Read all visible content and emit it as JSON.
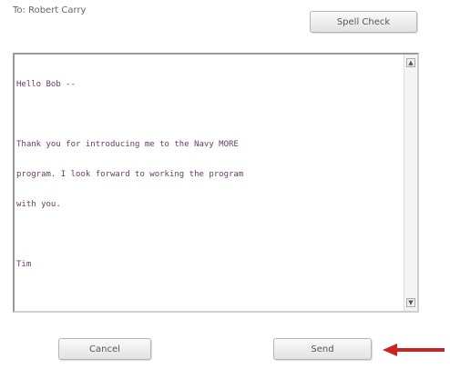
{
  "header": {
    "to_line": "To: Robert Carry"
  },
  "toolbar": {
    "spell_check_label": "Spell Check"
  },
  "message": {
    "lines": [
      "Hello Bob --",
      "",
      "Thank you for introducing me to the Navy MORE",
      "program. I look forward to working the program",
      "with you.",
      "",
      "Tim"
    ]
  },
  "actions": {
    "cancel_label": "Cancel",
    "send_label": "Send"
  },
  "icons": {
    "scroll_up": "scroll-up-icon",
    "scroll_down": "scroll-down-icon",
    "annotation_arrow": "red-arrow-icon"
  },
  "colors": {
    "annotation_arrow": "#cc2222",
    "message_text": "#6a3a6a"
  }
}
